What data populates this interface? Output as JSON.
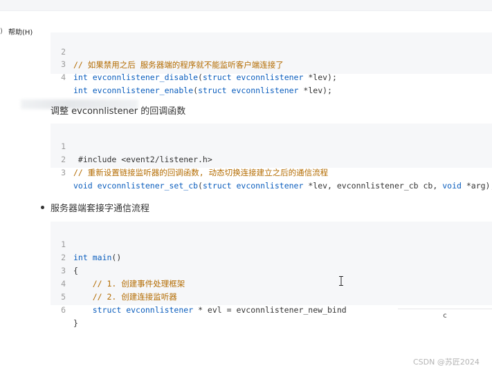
{
  "menu": {
    "help_label": "帮助(H)"
  },
  "block1": {
    "lines": [
      {
        "n": "2",
        "text": "// 如果禁用之后 服务器端的程序就不能监听客户端连接了"
      },
      {
        "n": "3",
        "text": "int evconnlistener_disable(struct evconnlistener *lev);"
      },
      {
        "n": "4",
        "text": "int evconnlistener_enable(struct evconnlistener *lev);"
      }
    ]
  },
  "section2": {
    "heading": "调整 evconnlistener 的回调函数"
  },
  "block2": {
    "lines": [
      {
        "n": "1",
        "text": " #include <event2/listener.h>"
      },
      {
        "n": "2",
        "text": "// 重新设置链接监听器的回调函数, 动态切换连接建立之后的通信流程"
      },
      {
        "n": "3",
        "text": "void evconnlistener_set_cb(struct evconnlistener *lev, evconnlistener_cb cb, void *arg);"
      }
    ]
  },
  "section3": {
    "bullet_text": "服务器端套接字通信流程"
  },
  "block3": {
    "lines": [
      {
        "n": "1",
        "text": "int main()"
      },
      {
        "n": "2",
        "text": "{"
      },
      {
        "n": "3",
        "text": "    // 1. 创建事件处理框架"
      },
      {
        "n": "4",
        "text": "    // 2. 创建连接监听器"
      },
      {
        "n": "5",
        "text": "    struct evconnlistener * evl = evconnlistener_new_bind"
      },
      {
        "n": "6",
        "text": "}"
      }
    ]
  },
  "overlay": {
    "c_label": "c"
  },
  "watermark": "CSDN @苏匠2024",
  "colors": {
    "keyword": "#0a5dbd",
    "comment": "#b36b00",
    "code_bg": "#f6f7f9"
  }
}
